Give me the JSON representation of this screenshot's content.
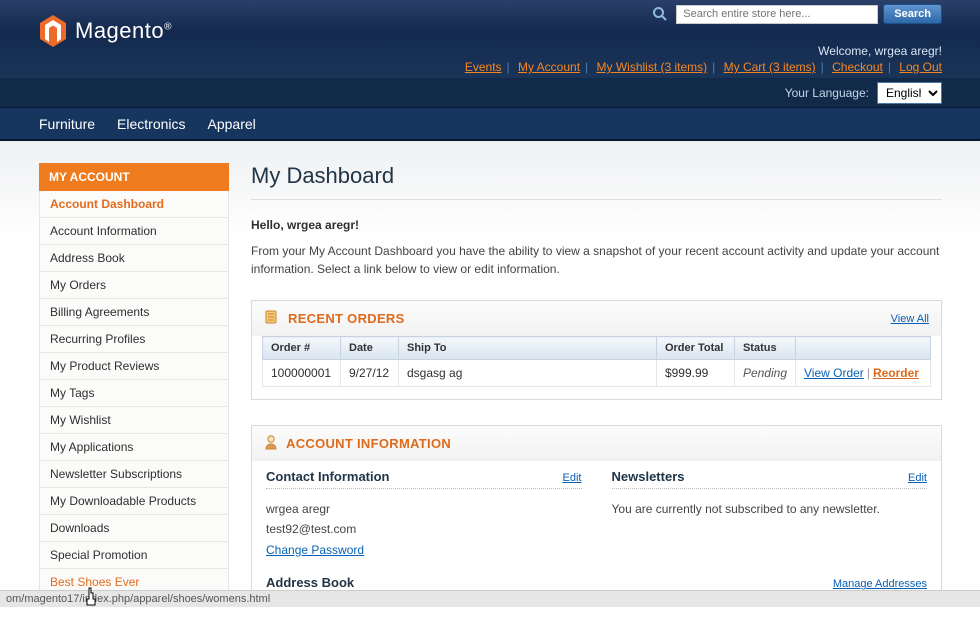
{
  "brand": "Magento",
  "search": {
    "placeholder": "Search entire store here...",
    "button": "Search"
  },
  "welcome": "Welcome, wrgea aregr!",
  "header_links": [
    {
      "label": "Events"
    },
    {
      "label": "My Account"
    },
    {
      "label": "My Wishlist (3 items)"
    },
    {
      "label": "My Cart (3 items)"
    },
    {
      "label": "Checkout"
    },
    {
      "label": "Log Out"
    }
  ],
  "language": {
    "label": "Your Language:",
    "value": "English"
  },
  "nav": [
    "Furniture",
    "Electronics",
    "Apparel"
  ],
  "sidebar": {
    "title": "MY ACCOUNT",
    "items": [
      {
        "label": "Account Dashboard",
        "active": true
      },
      {
        "label": "Account Information"
      },
      {
        "label": "Address Book"
      },
      {
        "label": "My Orders"
      },
      {
        "label": "Billing Agreements"
      },
      {
        "label": "Recurring Profiles"
      },
      {
        "label": "My Product Reviews"
      },
      {
        "label": "My Tags"
      },
      {
        "label": "My Wishlist"
      },
      {
        "label": "My Applications"
      },
      {
        "label": "Newsletter Subscriptions"
      },
      {
        "label": "My Downloadable Products"
      },
      {
        "label": "Downloads"
      },
      {
        "label": "Special Promotion"
      },
      {
        "label": "Best Shoes Ever",
        "highlight": true
      }
    ]
  },
  "page_title": "My Dashboard",
  "hello": "Hello, wrgea aregr!",
  "intro": "From your My Account Dashboard you have the ability to view a snapshot of your recent account activity and update your account information. Select a link below to view or edit information.",
  "recent_orders": {
    "title": "RECENT ORDERS",
    "view_all": "View All",
    "headers": [
      "Order #",
      "Date",
      "Ship To",
      "Order Total",
      "Status",
      ""
    ],
    "rows": [
      {
        "order_no": "100000001",
        "date": "9/27/12",
        "ship_to": "dsgasg ag",
        "total": "$999.99",
        "status": "Pending",
        "view": "View Order",
        "reorder": "Reorder"
      }
    ]
  },
  "account_info": {
    "title": "ACCOUNT INFORMATION",
    "contact": {
      "title": "Contact Information",
      "edit": "Edit",
      "name": "wrgea aregr",
      "email": "test92@test.com",
      "change_pw": "Change Password"
    },
    "newsletters": {
      "title": "Newsletters",
      "edit": "Edit",
      "text": "You are currently not subscribed to any newsletter."
    },
    "address": {
      "title": "Address Book",
      "manage": "Manage Addresses"
    }
  },
  "status_url": "om/magento17/index.php/apparel/shoes/womens.html"
}
